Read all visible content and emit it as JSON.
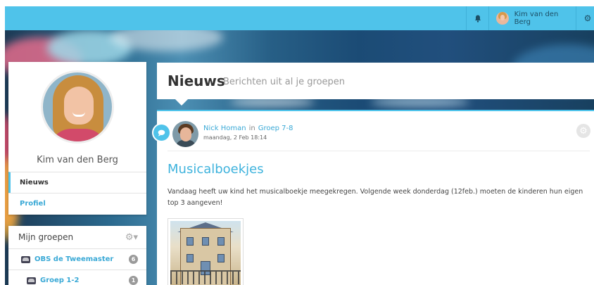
{
  "topbar": {
    "user_name": "Kim van den Berg",
    "bell_icon": "bell-icon",
    "settings_icon": "cogs-icon"
  },
  "profile": {
    "name": "Kim van den Berg",
    "nav": [
      {
        "label": "Nieuws",
        "active": true
      },
      {
        "label": "Profiel",
        "active": false
      }
    ]
  },
  "groups": {
    "title": "Mijn groepen",
    "items": [
      {
        "label": "OBS de Tweemaster",
        "count": "6"
      },
      {
        "label": "Groep 1-2",
        "count": "1"
      }
    ]
  },
  "page": {
    "title": "Nieuws",
    "subtitle": "Berichten uit al je groepen"
  },
  "post": {
    "author": "Nick Homan",
    "in_label": "in",
    "group": "Groep 7-8",
    "date": "maandag, 2 Feb 18:14",
    "title": "Musicalboekjes",
    "body": "Vandaag heeft uw kind het musicalboekje meegekregen. Volgende week donderdag (12feb.) moeten de kinderen hun eigen top 3 aangeven!"
  },
  "colors": {
    "accent": "#4fc3ea",
    "link": "#3aa9d6"
  }
}
